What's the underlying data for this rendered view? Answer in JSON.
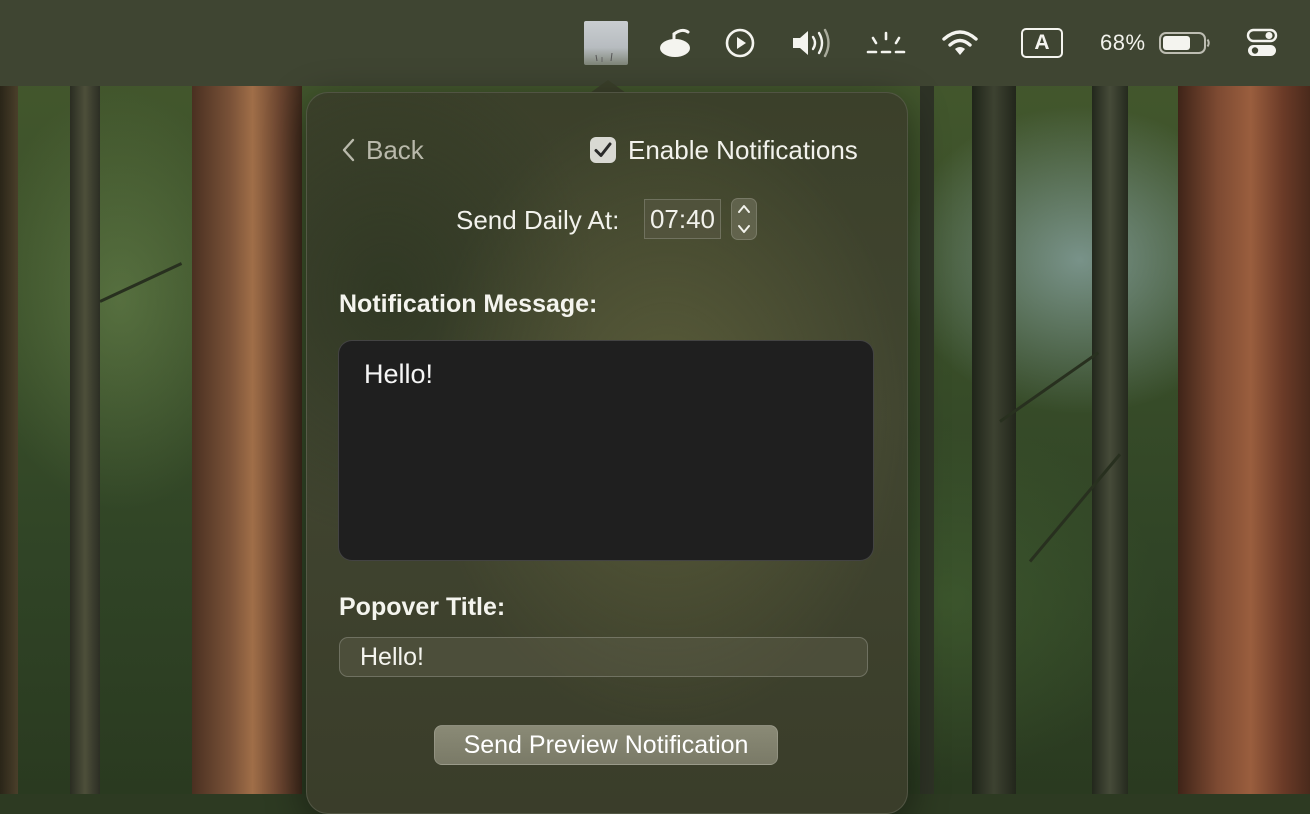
{
  "menubar": {
    "icons": [
      {
        "name": "app-thumbnail-icon"
      },
      {
        "name": "flying-saucer-icon"
      },
      {
        "name": "play-circle-icon"
      },
      {
        "name": "volume-icon"
      },
      {
        "name": "night-shift-icon"
      },
      {
        "name": "wifi-icon"
      },
      {
        "name": "input-source-icon",
        "label": "A"
      },
      {
        "name": "battery-icon"
      },
      {
        "name": "control-center-icon"
      }
    ],
    "battery_percent": "68%",
    "battery_level": 0.68,
    "input_source_label": "A"
  },
  "popover": {
    "back_label": "Back",
    "enable_notifications": {
      "label": "Enable Notifications",
      "checked": true
    },
    "send_daily_label": "Send Daily At:",
    "send_time": "07:40",
    "message_label": "Notification Message:",
    "message_value": "Hello!",
    "title_label": "Popover Title:",
    "title_value": "Hello!",
    "preview_button": "Send Preview Notification"
  },
  "colors": {
    "menubar": "#3f4532",
    "popover": "#3b402a",
    "text": "#f2f2ec",
    "dim_text": "#b9b9ab",
    "message_box": "#1f1f1f"
  }
}
